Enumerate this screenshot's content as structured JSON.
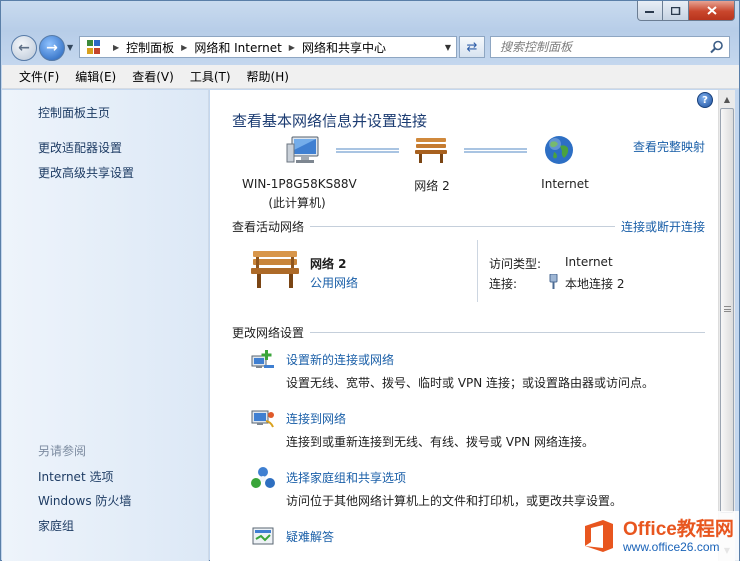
{
  "window": {
    "caption_buttons": {
      "minimize_icon": "minimize-icon",
      "maximize_icon": "maximize-icon",
      "close_icon": "close-icon"
    }
  },
  "navigation": {
    "breadcrumb": [
      "控制面板",
      "网络和 Internet",
      "网络和共享中心"
    ],
    "search_placeholder": "搜索控制面板"
  },
  "menu": [
    "文件(F)",
    "编辑(E)",
    "查看(V)",
    "工具(T)",
    "帮助(H)"
  ],
  "sidebar": {
    "links": [
      "控制面板主页",
      "更改适配器设置",
      "更改高级共享设置"
    ],
    "see_also_heading": "另请参阅",
    "see_also": [
      "Internet 选项",
      "Windows 防火墙",
      "家庭组"
    ]
  },
  "main": {
    "title": "查看基本网络信息并设置连接",
    "full_map_link": "查看完整映射",
    "map": {
      "computer_name": "WIN-1P8G58KS88V",
      "computer_sub": "(此计算机)",
      "network": "网络  2",
      "internet": "Internet"
    },
    "active_networks": {
      "heading": "查看活动网络",
      "connect_link": "连接或断开连接",
      "network_name": "网络  2",
      "network_type": "公用网络",
      "access_type_label": "访问类型:",
      "access_type_value": "Internet",
      "connections_label": "连接:",
      "connections_value": "本地连接 2"
    },
    "change_settings": {
      "heading": "更改网络设置",
      "tasks": [
        {
          "title": "设置新的连接或网络",
          "desc": "设置无线、宽带、拨号、临时或 VPN 连接；或设置路由器或访问点。",
          "icon": "new-connection-icon"
        },
        {
          "title": "连接到网络",
          "desc": "连接到或重新连接到无线、有线、拨号或 VPN 网络连接。",
          "icon": "connect-network-icon"
        },
        {
          "title": "选择家庭组和共享选项",
          "desc": "访问位于其他网络计算机上的文件和打印机，或更改共享设置。",
          "icon": "homegroup-icon"
        },
        {
          "title": "疑难解答",
          "desc": "",
          "icon": "troubleshoot-icon"
        }
      ]
    }
  },
  "watermark": {
    "brand_latin": "Office",
    "brand_cn": "教程网",
    "url": "www.office26.com"
  },
  "colors": {
    "link": "#1a5fa8",
    "title": "#1c3c72",
    "watermark_orange": "#e8561f",
    "watermark_blue": "#1a63b8"
  }
}
